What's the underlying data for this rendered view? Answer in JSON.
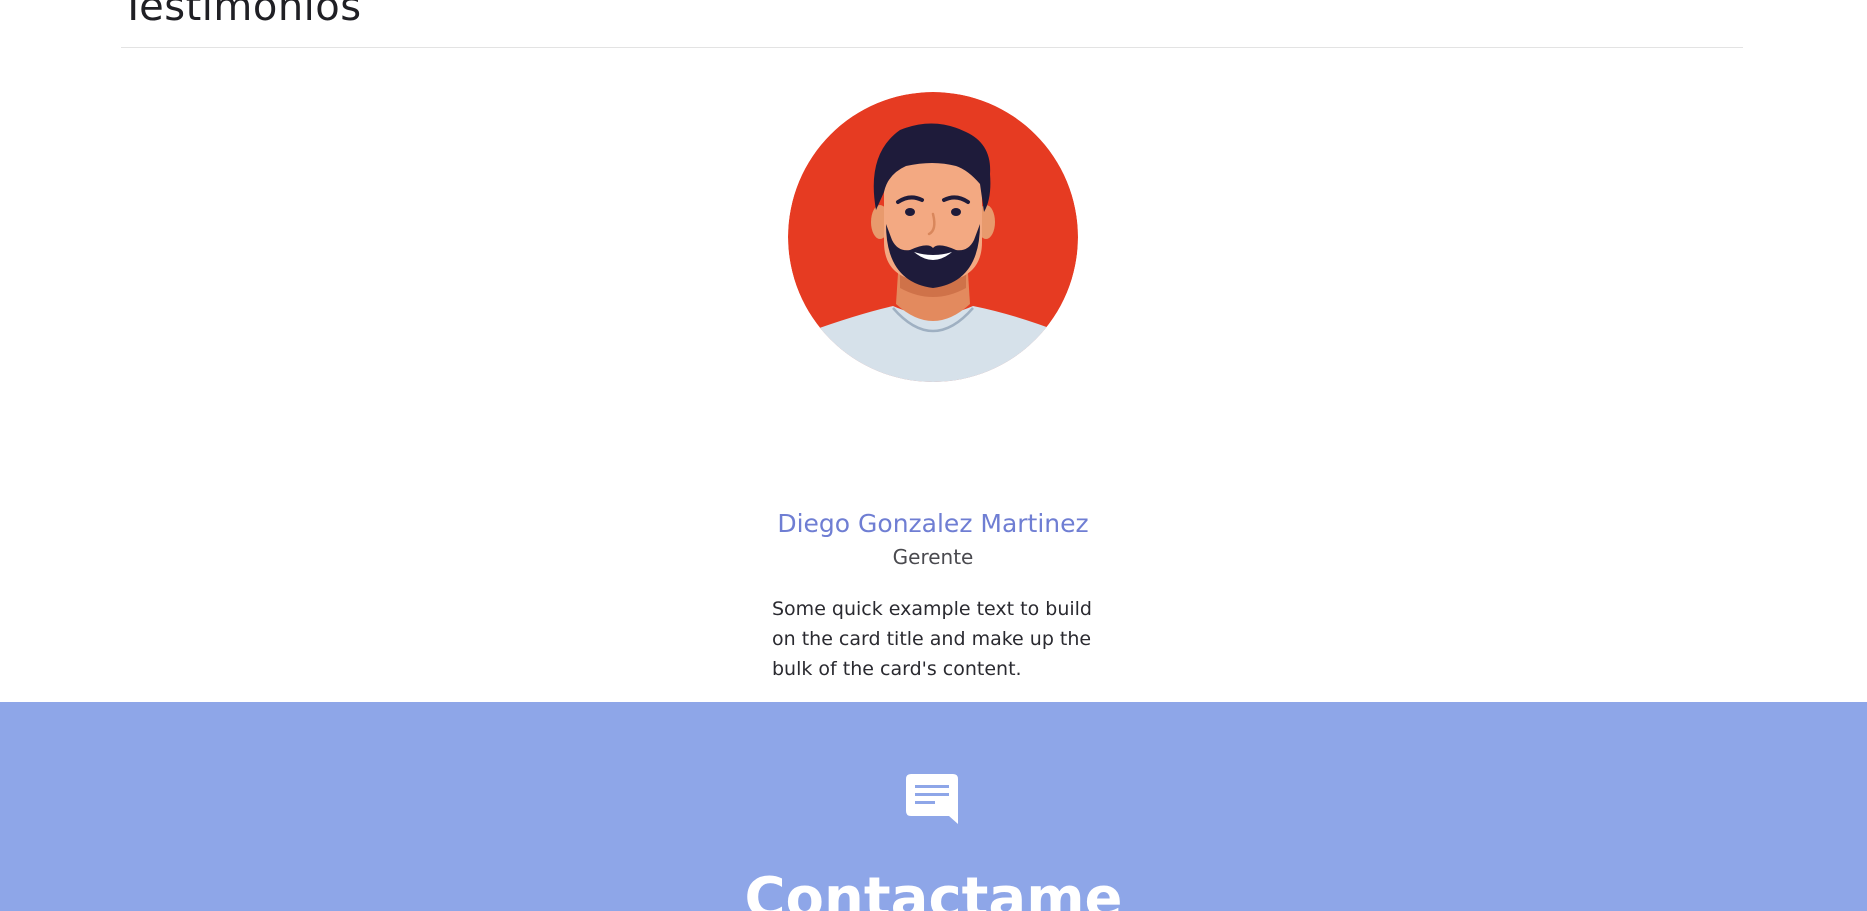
{
  "testimonials": {
    "title": "Testimonios",
    "card": {
      "name": "Diego Gonzalez Martinez",
      "role": "Gerente",
      "text": "Some quick example text to build on the card title and make up the bulk of the card's content.",
      "avatar_icon": "man-with-beard-avatar"
    }
  },
  "contact": {
    "icon": "chat-bubble-icon",
    "title": "Contactame"
  },
  "colors": {
    "accent": "#6f7ed3",
    "contact_background": "#8ea6e8",
    "avatar_background": "#e63b22"
  }
}
